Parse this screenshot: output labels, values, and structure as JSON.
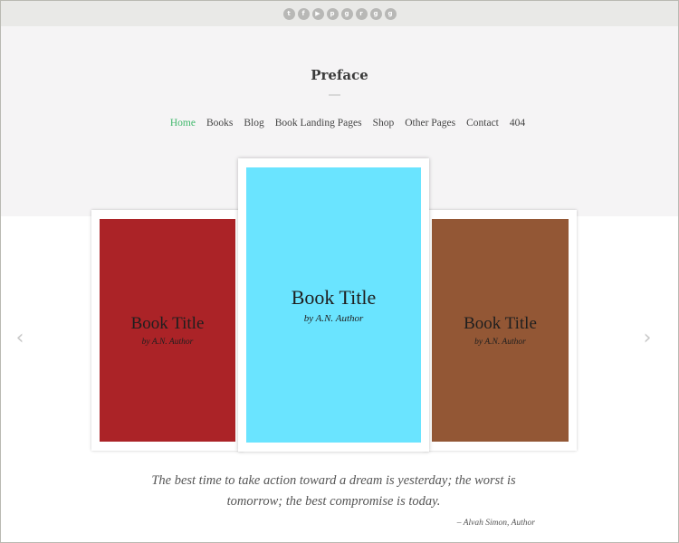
{
  "social": [
    {
      "icon": "twitter-icon",
      "glyph": "t"
    },
    {
      "icon": "facebook-icon",
      "glyph": "f"
    },
    {
      "icon": "youtube-icon",
      "glyph": "▶"
    },
    {
      "icon": "pinterest-icon",
      "glyph": "p"
    },
    {
      "icon": "github-icon",
      "glyph": "g"
    },
    {
      "icon": "reddit-icon",
      "glyph": "r"
    },
    {
      "icon": "google-plus-icon",
      "glyph": "g"
    },
    {
      "icon": "goodreads-icon",
      "glyph": "g"
    }
  ],
  "header": {
    "title": "Preface",
    "background": "#f5f4f5"
  },
  "nav": {
    "items": [
      "Home",
      "Books",
      "Blog",
      "Book Landing Pages",
      "Shop",
      "Other Pages",
      "Contact",
      "404"
    ],
    "active": "Home",
    "active_color": "#41b86c"
  },
  "carousel": {
    "prev_glyph": "‹",
    "next_glyph": "›",
    "books": [
      {
        "title": "Book Title",
        "author": "by A.N. Author",
        "color": "#ab2327"
      },
      {
        "title": "Book Title",
        "author": "by A.N. Author",
        "color": "#6ae4ff"
      },
      {
        "title": "Book Title",
        "author": "by A.N. Author",
        "color": "#935735"
      }
    ]
  },
  "quote": {
    "text": "The best time to take action toward a dream is yesterday; the worst is tomorrow; the best compromise is today.",
    "attribution": "– Alvah Simon, Author"
  }
}
